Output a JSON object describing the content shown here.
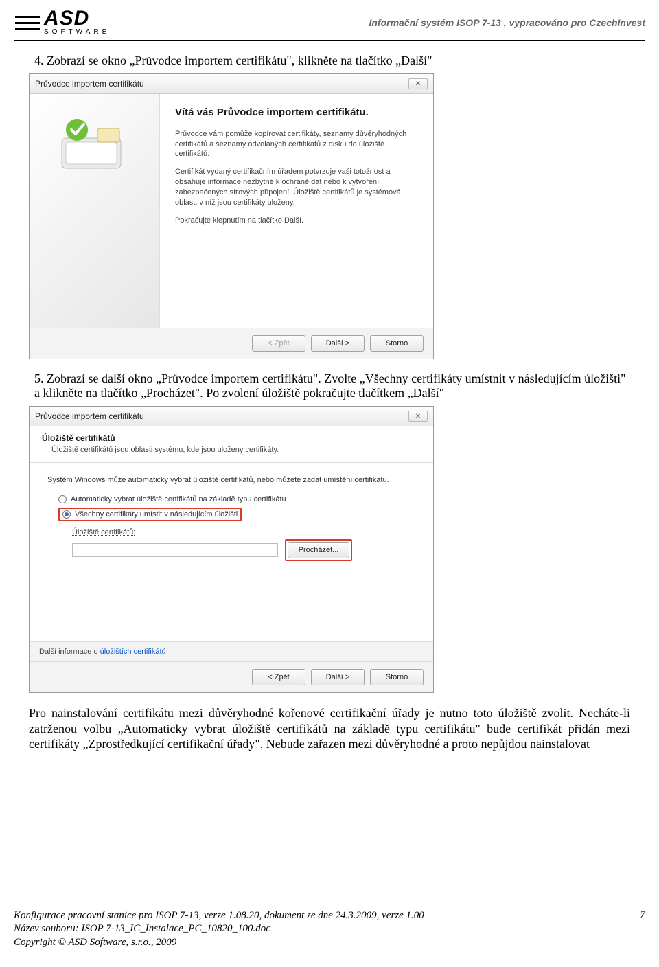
{
  "header": {
    "logo_text": "ASD",
    "logo_sub": "SOFTWARE",
    "right": "Informační systém ISOP 7-13 , vypracováno pro CzechInvest"
  },
  "step4": "4.   Zobrazí se okno „Průvodce importem certifikátu\", klikněte na tlačítko „Další\"",
  "wiz1": {
    "title": "Průvodce importem certifikátu",
    "heading": "Vítá vás Průvodce importem certifikátu.",
    "p1": "Průvodce vám pomůže kopírovat certifikáty, seznamy důvěryhodných certifikátů a seznamy odvolaných certifikátů z disku do úložiště certifikátů.",
    "p2": "Certifikát vydaný certifikačním úřadem potvrzuje vaši totožnost a obsahuje informace nezbytné k ochraně dat nebo k vytvoření zabezpečených síťových připojení. Úložiště certifikátů je systémová oblast, v níž jsou certifikáty uloženy.",
    "p3": "Pokračujte klepnutím na tlačítko Další.",
    "btn_back": "< Zpět",
    "btn_next": "Další >",
    "btn_cancel": "Storno"
  },
  "step5": "5.   Zobrazí se další okno „Průvodce importem certifikátu\". Zvolte „Všechny certifikáty umístnit v následujícím úložišti\" a klikněte na tlačítko „Procházet\". Po zvolení úložiště pokračujte tlačítkem „Další\"",
  "wiz2": {
    "title": "Průvodce importem certifikátu",
    "header_t1": "Úložiště certifikátů",
    "header_t2": "Úložiště certifikátů jsou oblasti systému, kde jsou uloženy certifikáty.",
    "intro": "Systém Windows může automaticky vybrat úložiště certifikátů, nebo můžete zadat umístění certifikátu.",
    "opt1": "Automaticky vybrat úložiště certifikátů na základě typu certifikátu",
    "opt2": "Všechny certifikáty umístit v následujícím úložišti",
    "store_label": "Úložiště certifikátů:",
    "browse": "Procházet...",
    "link_prefix": "Další informace o ",
    "link_text": "úložištích certifikátů",
    "btn_back": "< Zpět",
    "btn_next": "Další >",
    "btn_cancel": "Storno"
  },
  "after_text": "Pro nainstalování certifikátu mezi důvěryhodné kořenové certifikační úřady je nutno toto úložiště zvolit. Necháte-li zatrženou volbu „Automaticky vybrat úložiště certifikátů na základě typu certifikátu\" bude certifikát přidán mezi certifikáty „Zprostředkující certifikační úřady\". Nebude zařazen mezi důvěryhodné a proto nepůjdou nainstalovat",
  "footer": {
    "line1": "Konfigurace pracovní stanice pro ISOP 7-13, verze 1.08.20, dokument ze dne 24.3.2009, verze 1.00",
    "line2": "Název souboru: ISOP 7-13_IC_Instalace_PC_10820_100.doc",
    "line3": "Copyright © ASD Software, s.r.o., 2009",
    "page": "7"
  }
}
